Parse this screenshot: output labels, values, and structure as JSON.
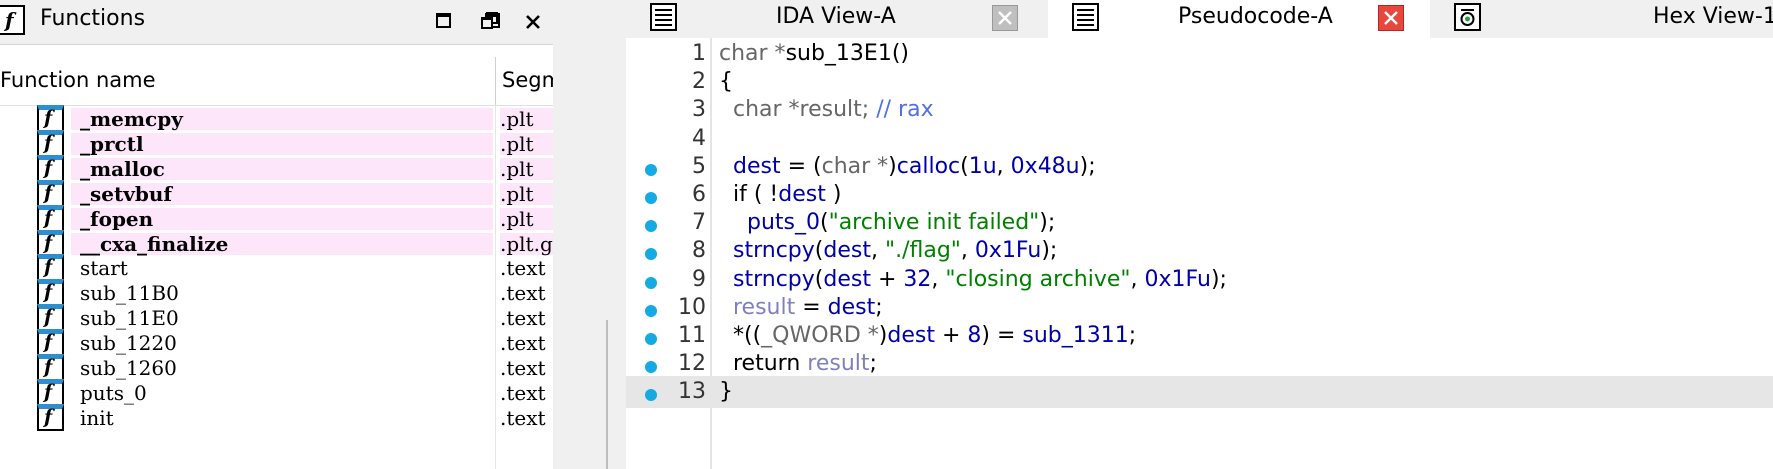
{
  "functions_panel": {
    "title": "Functions",
    "columns": [
      "Function name",
      "Segmen"
    ],
    "rows": [
      {
        "name": "_memcpy",
        "segment": ".plt",
        "highlight": true
      },
      {
        "name": "_prctl",
        "segment": ".plt",
        "highlight": true
      },
      {
        "name": "_malloc",
        "segment": ".plt",
        "highlight": true
      },
      {
        "name": "_setvbuf",
        "segment": ".plt",
        "highlight": true
      },
      {
        "name": "_fopen",
        "segment": ".plt",
        "highlight": true
      },
      {
        "name": "__cxa_finalize",
        "segment": ".plt.go",
        "highlight": true
      },
      {
        "name": "start",
        "segment": ".text",
        "highlight": false
      },
      {
        "name": "sub_11B0",
        "segment": ".text",
        "highlight": false
      },
      {
        "name": "sub_11E0",
        "segment": ".text",
        "highlight": false
      },
      {
        "name": "sub_1220",
        "segment": ".text",
        "highlight": false
      },
      {
        "name": "sub_1260",
        "segment": ".text",
        "highlight": false
      },
      {
        "name": "puts_0",
        "segment": ".text",
        "highlight": false
      },
      {
        "name": "init",
        "segment": ".text",
        "highlight": false
      }
    ]
  },
  "tabs": [
    {
      "label": "IDA View-A",
      "active": false
    },
    {
      "label": "Pseudocode-A",
      "active": true
    },
    {
      "label": "Hex View-1",
      "active": false
    }
  ],
  "code": {
    "lines": [
      {
        "n": "1",
        "bp": false,
        "html": "<span class='t'>char *</span><span class='p'>sub_13E1()</span>"
      },
      {
        "n": "2",
        "bp": false,
        "html": "<span class='p'>{</span>"
      },
      {
        "n": "3",
        "bp": false,
        "html": "  <span class='t'>char *result; </span><span class='c'>// rax</span>"
      },
      {
        "n": "4",
        "bp": false,
        "html": ""
      },
      {
        "n": "5",
        "bp": true,
        "html": "  <span class='kb'>dest</span><span class='p'> = (</span><span class='t'>char *</span><span class='p'>)</span><span class='kb'>calloc</span><span class='p'>(</span><span class='kb'>1u</span><span class='p'>, </span><span class='kb'>0x48u</span><span class='p'>);</span>"
      },
      {
        "n": "6",
        "bp": true,
        "html": "  <span class='p'>if ( !</span><span class='kb'>dest</span><span class='p'> )</span>"
      },
      {
        "n": "7",
        "bp": true,
        "html": "    <span class='kb'>puts_0</span><span class='p'>(</span><span class='s'>\"archive init failed\"</span><span class='p'>);</span>"
      },
      {
        "n": "8",
        "bp": true,
        "html": "  <span class='kb'>strncpy</span><span class='p'>(</span><span class='kb'>dest</span><span class='p'>, </span><span class='s'>\"./flag\"</span><span class='p'>, </span><span class='kb'>0x1Fu</span><span class='p'>);</span>"
      },
      {
        "n": "9",
        "bp": true,
        "html": "  <span class='kb'>strncpy</span><span class='p'>(</span><span class='kb'>dest</span><span class='p'> + </span><span class='kb'>32</span><span class='p'>, </span><span class='s'>\"closing archive\"</span><span class='p'>, </span><span class='kb'>0x1Fu</span><span class='p'>);</span>"
      },
      {
        "n": "10",
        "bp": true,
        "html": "  <span class='g'>result</span><span class='p'> = </span><span class='kb'>dest</span><span class='p'>;</span>"
      },
      {
        "n": "11",
        "bp": true,
        "html": "  <span class='p'>*((</span><span class='t'>_QWORD *</span><span class='p'>)</span><span class='kb'>dest</span><span class='p'> + </span><span class='kb'>8</span><span class='p'>) = </span><span class='kb'>sub_1311</span><span class='p'>;</span>"
      },
      {
        "n": "12",
        "bp": true,
        "html": "  <span class='p'>return </span><span class='g'>result</span><span class='p'>;</span>"
      },
      {
        "n": "13",
        "bp": true,
        "html": "<span class='p'>}</span>"
      }
    ]
  }
}
